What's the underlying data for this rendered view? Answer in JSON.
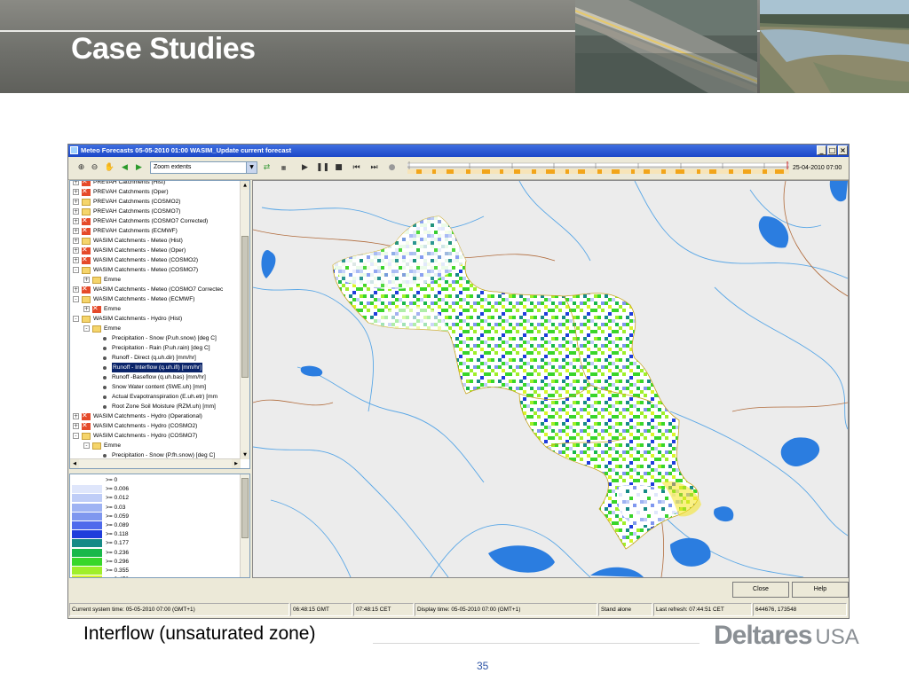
{
  "slide": {
    "title": "Case Studies",
    "caption": "Interflow (unsaturated zone)",
    "page_number": "35",
    "logo_text": "Deltares",
    "logo_suffix": "USA"
  },
  "window": {
    "title": "Meteo Forecasts 05-05-2010 01:00 WASIM_Update current forecast",
    "controls": [
      "_",
      "□",
      "×"
    ]
  },
  "toolbar": {
    "zoom_select": "Zoom extents",
    "timestamp": "25-04-2010 07:00",
    "icons": [
      "zoom-in-icon",
      "zoom-out-icon",
      "pan-icon",
      "back-icon",
      "forward-icon",
      "refresh-icon",
      "play-icon",
      "pause-icon",
      "stop-icon",
      "step-back-icon",
      "step-forward-icon",
      "record-icon"
    ]
  },
  "tree": {
    "items": [
      {
        "label": "PREVAH Catchments (Hist)",
        "icon": "x",
        "exp": "+"
      },
      {
        "label": "PREVAH Catchments (Oper)",
        "icon": "x",
        "exp": "+"
      },
      {
        "label": "PREVAH Catchments (COSMO2)",
        "icon": "f",
        "exp": "+"
      },
      {
        "label": "PREVAH Catchments (COSMO7)",
        "icon": "f",
        "exp": "+"
      },
      {
        "label": "PREVAH Catchments (COSMO7 Corrected)",
        "icon": "x",
        "exp": "+"
      },
      {
        "label": "PREVAH Catchments (ECMWF)",
        "icon": "x",
        "exp": "+"
      },
      {
        "label": "WASIM Catchments - Meteo  (Hist)",
        "icon": "f",
        "exp": "+"
      },
      {
        "label": "WASIM Catchments - Meteo  (Oper)",
        "icon": "x",
        "exp": "+"
      },
      {
        "label": "WASIM Catchments - Meteo  (COSMO2)",
        "icon": "x",
        "exp": "+"
      },
      {
        "label": "WASIM Catchments - Meteo  (COSMO7)",
        "icon": "f",
        "exp": "-"
      },
      {
        "label": "Emme",
        "icon": "f",
        "exp": "+",
        "indent": 1
      },
      {
        "label": "WASIM Catchments - Meteo  (COSMO7 Correctec",
        "icon": "x",
        "exp": "+"
      },
      {
        "label": "WASIM Catchments - Meteo  (ECMWF)",
        "icon": "f",
        "exp": "-"
      },
      {
        "label": "Emme",
        "icon": "x",
        "exp": "+",
        "indent": 1
      },
      {
        "label": "WASIM Catchments - Hydro  (Hist)",
        "icon": "f",
        "exp": "-"
      },
      {
        "label": "Emme",
        "icon": "f",
        "exp": "-",
        "indent": 1
      },
      {
        "label": "Precipitation - Snow  (P.uh.snow) [deg C]",
        "icon": "dot",
        "indent": 2
      },
      {
        "label": "Precipitation - Rain  (P.uh.rain) [deg C]",
        "icon": "dot",
        "indent": 2
      },
      {
        "label": "Runoff - Direct  (q.uh.dir) [mm/hr]",
        "icon": "dot",
        "indent": 2
      },
      {
        "label": "Runoff - Interflow  (q.uh.ifl) [mm/hr]",
        "icon": "dot",
        "indent": 2,
        "selected": true
      },
      {
        "label": "Runoff -Baseflow  (q.uh.bas) [mm/hr]",
        "icon": "dot",
        "indent": 2
      },
      {
        "label": "Snow Water content (SWE.uh) [mm]",
        "icon": "dot",
        "indent": 2
      },
      {
        "label": "Actual Evapotranspiration (E.uh.etr) [mm",
        "icon": "dot",
        "indent": 2
      },
      {
        "label": "Root Zone Soil Moisture  (RZM.uh) [mm]",
        "icon": "dot",
        "indent": 2
      },
      {
        "label": "WASIM Catchments - Hydro  (Operational)",
        "icon": "x",
        "exp": "+"
      },
      {
        "label": "WASIM Catchments - Hydro  (COSMO2)",
        "icon": "x",
        "exp": "+"
      },
      {
        "label": "WASIM Catchments - Hydro  (COSMO7)",
        "icon": "f",
        "exp": "-"
      },
      {
        "label": "Emme",
        "icon": "f",
        "exp": "-",
        "indent": 1
      },
      {
        "label": "Precipitation - Snow  (P.fh.snow) [deg C]",
        "icon": "dot",
        "indent": 2
      }
    ]
  },
  "legend": {
    "items": [
      {
        "label": ">= 0",
        "color": "#ffffff"
      },
      {
        "label": ">= 0.006",
        "color": "#dfe6fb"
      },
      {
        "label": ">= 0.012",
        "color": "#bfcdf7"
      },
      {
        "label": ">= 0.03",
        "color": "#9fb3f3"
      },
      {
        "label": ">= 0.059",
        "color": "#7f97ef"
      },
      {
        "label": ">= 0.089",
        "color": "#4f6aec"
      },
      {
        "label": ">= 0.118",
        "color": "#1f3ddc"
      },
      {
        "label": ">= 0.177",
        "color": "#168a86"
      },
      {
        "label": ">= 0.236",
        "color": "#18b84a"
      },
      {
        "label": ">= 0.296",
        "color": "#38d72a"
      },
      {
        "label": ">= 0.355",
        "color": "#9fef2a"
      },
      {
        "label": ">= 0.473",
        "color": "#d8f52a"
      }
    ]
  },
  "buttons": {
    "close": "Close",
    "help": "Help"
  },
  "status": {
    "system_time": "Current system time: 05-05-2010 07:00 (GMT+1)",
    "gmt": "06:48:15 GMT",
    "cet": "07:48:15 CET",
    "display_time": "Display time: 05-05-2010 07:00 (GMT+1)",
    "mode": "Stand alone",
    "last_refresh": "Last refresh: 07:44:51 CET",
    "coords": "644676, 173548"
  }
}
